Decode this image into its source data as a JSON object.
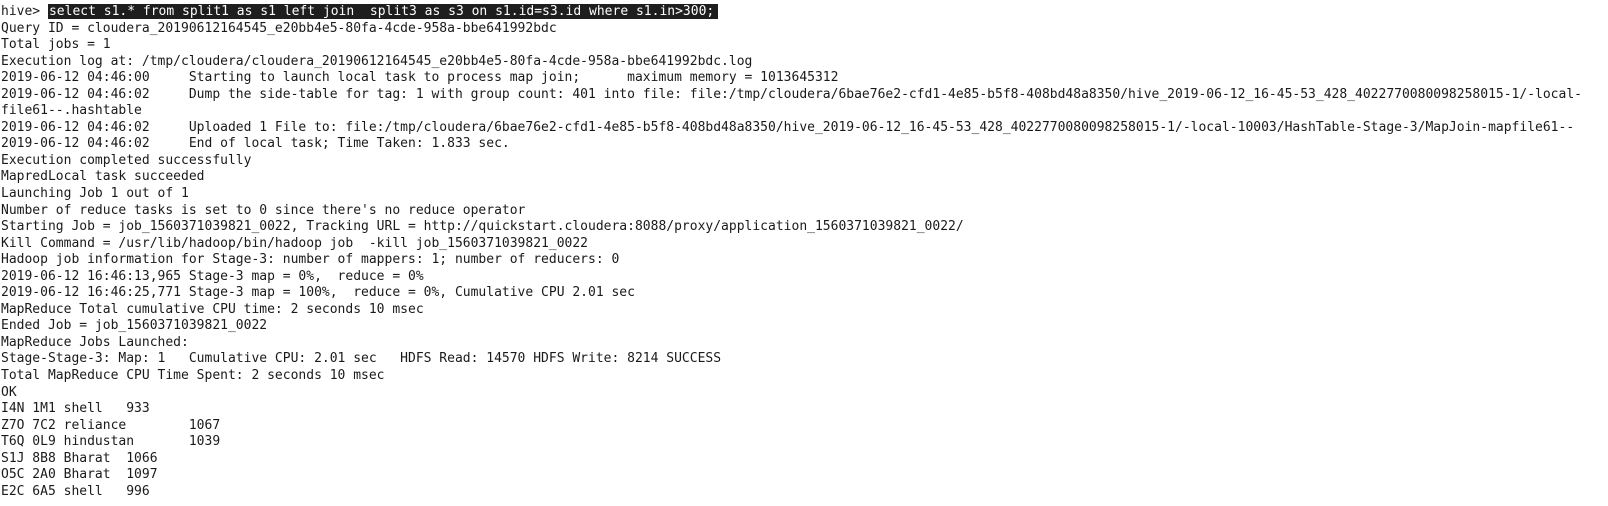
{
  "prompt": "hive> ",
  "command": "select s1.* from split1 as s1 left join  split3 as s3 on s1.id=s3.id where s1.in>300;",
  "output": [
    "Query ID = cloudera_20190612164545_e20bb4e5-80fa-4cde-958a-bbe641992bdc",
    "Total jobs = 1",
    "Execution log at: /tmp/cloudera/cloudera_20190612164545_e20bb4e5-80fa-4cde-958a-bbe641992bdc.log",
    "2019-06-12 04:46:00     Starting to launch local task to process map join;      maximum memory = 1013645312",
    "2019-06-12 04:46:02     Dump the side-table for tag: 1 with group count: 401 into file: file:/tmp/cloudera/6bae76e2-cfd1-4e85-b5f8-408bd48a8350/hive_2019-06-12_16-45-53_428_4022770080098258015-1/-local-",
    "file61--.hashtable",
    "2019-06-12 04:46:02     Uploaded 1 File to: file:/tmp/cloudera/6bae76e2-cfd1-4e85-b5f8-408bd48a8350/hive_2019-06-12_16-45-53_428_4022770080098258015-1/-local-10003/HashTable-Stage-3/MapJoin-mapfile61--",
    "2019-06-12 04:46:02     End of local task; Time Taken: 1.833 sec.",
    "Execution completed successfully",
    "MapredLocal task succeeded",
    "Launching Job 1 out of 1",
    "Number of reduce tasks is set to 0 since there's no reduce operator",
    "Starting Job = job_1560371039821_0022, Tracking URL = http://quickstart.cloudera:8088/proxy/application_1560371039821_0022/",
    "Kill Command = /usr/lib/hadoop/bin/hadoop job  -kill job_1560371039821_0022",
    "Hadoop job information for Stage-3: number of mappers: 1; number of reducers: 0",
    "2019-06-12 16:46:13,965 Stage-3 map = 0%,  reduce = 0%",
    "2019-06-12 16:46:25,771 Stage-3 map = 100%,  reduce = 0%, Cumulative CPU 2.01 sec",
    "MapReduce Total cumulative CPU time: 2 seconds 10 msec",
    "Ended Job = job_1560371039821_0022",
    "MapReduce Jobs Launched:",
    "Stage-Stage-3: Map: 1   Cumulative CPU: 2.01 sec   HDFS Read: 14570 HDFS Write: 8214 SUCCESS",
    "Total MapReduce CPU Time Spent: 2 seconds 10 msec",
    "OK",
    "I4N 1M1 shell   933",
    "Z7O 7C2 reliance        1067",
    "T6Q 0L9 hindustan       1039",
    "S1J 8B8 Bharat  1066",
    "O5C 2A0 Bharat  1097",
    "E2C 6A5 shell   996"
  ]
}
